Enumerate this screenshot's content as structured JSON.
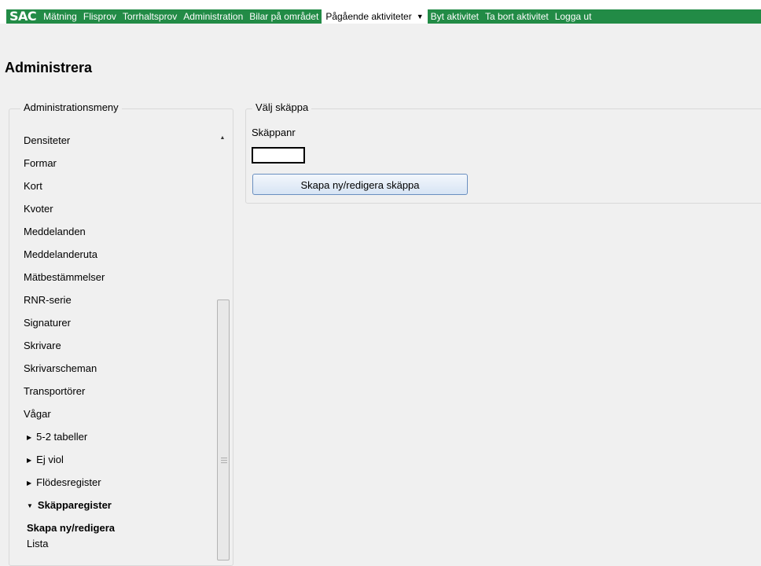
{
  "nav": {
    "logo": "SAC",
    "items": [
      "Mätning",
      "Flisprov",
      "Torrhaltsprov",
      "Administration",
      "Bilar på området"
    ],
    "active_label": "Pågående aktiviteter",
    "right_items": [
      "Byt aktivitet",
      "Ta bort aktivitet",
      "Logga ut"
    ]
  },
  "page": {
    "title": "Administrera"
  },
  "sidebar": {
    "legend": "Administrationsmeny",
    "items": [
      "Densiteter",
      "Formar",
      "Kort",
      "Kvoter",
      "Meddelanden",
      "Meddelanderuta",
      "Mätbestämmelser",
      "RNR-serie",
      "Signaturer",
      "Skrivare",
      "Skrivarscheman",
      "Transportörer",
      "Vågar"
    ],
    "collapsed_groups": [
      "5-2 tabeller",
      "Ej viol",
      "Flödesregister"
    ],
    "expanded_group": "Skäpparegister",
    "children": [
      "Skapa ny/redigera",
      "Lista"
    ]
  },
  "form": {
    "legend": "Välj skäppa",
    "field_label": "Skäppanr",
    "field_value": "",
    "button_label": "Skapa ny/redigera skäppa"
  },
  "icons": {
    "dropdown": "caret-down-icon",
    "collapsed": "triangle-right-icon",
    "expanded": "triangle-down-icon",
    "scroll_up": "scroll-up-arrow-icon"
  },
  "colors": {
    "nav_bg": "#228b46",
    "page_bg": "#f0f0f0"
  }
}
